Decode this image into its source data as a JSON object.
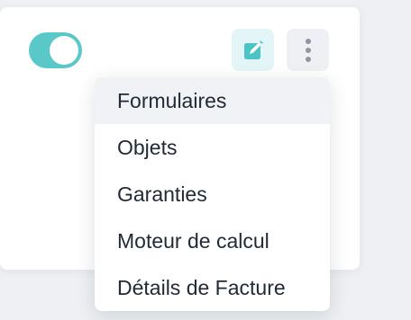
{
  "toolbar": {
    "toggle": {
      "state": "on",
      "color": "#5ac8c8"
    },
    "edit_button": {
      "icon": "edit-icon",
      "color": "#4cc4c6",
      "background": "#e3f5f6"
    },
    "more_button": {
      "icon": "more-vertical-icon",
      "color": "#9097a3",
      "background": "#eef0f4"
    }
  },
  "menu": {
    "items": [
      {
        "label": "Formulaires",
        "active": true
      },
      {
        "label": "Objets",
        "active": false
      },
      {
        "label": "Garanties",
        "active": false
      },
      {
        "label": "Moteur de calcul",
        "active": false
      },
      {
        "label": "Détails de Facture",
        "active": false
      }
    ]
  }
}
